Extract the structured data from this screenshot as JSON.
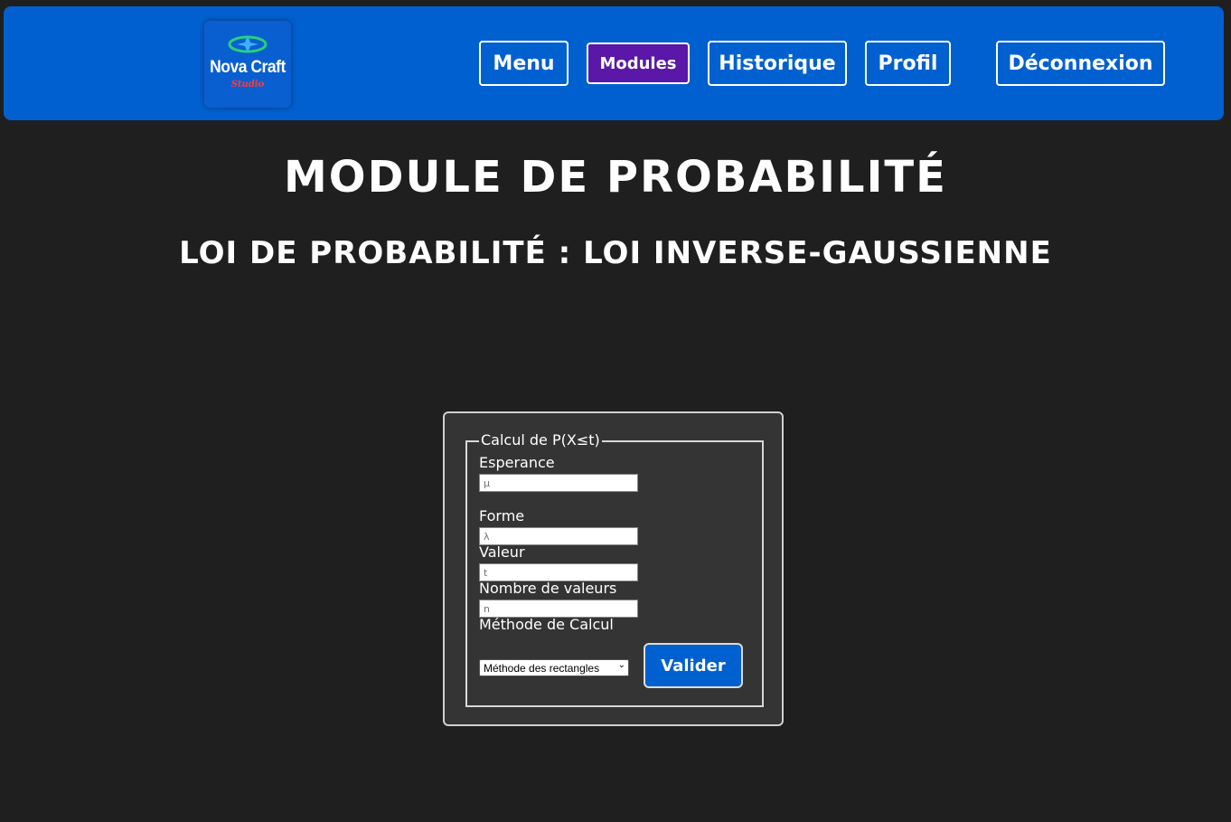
{
  "header": {
    "logo": {
      "name": "Nova Craft",
      "sub": "Studio"
    },
    "nav": [
      {
        "label": "Menu"
      },
      {
        "label": "Modules",
        "active": true
      },
      {
        "label": "Historique"
      },
      {
        "label": "Profil"
      },
      {
        "label": "Déconnexion"
      }
    ]
  },
  "page": {
    "title": "MODULE DE PROBABILITÉ",
    "subtitle": "LOI DE PROBABILITÉ : LOI INVERSE-GAUSSIENNE"
  },
  "form": {
    "legend": "Calcul de P(X≤t)",
    "fields": [
      {
        "label": "Esperance",
        "placeholder": "μ"
      },
      {
        "label": "Forme",
        "placeholder": "λ"
      },
      {
        "label": "Valeur",
        "placeholder": "t"
      },
      {
        "label": "Nombre de valeurs",
        "placeholder": "n"
      }
    ],
    "method_label": "Méthode de Calcul",
    "method_selected": "Méthode des rectangles",
    "submit": "Valider"
  },
  "colors": {
    "header_bg": "#0060d0",
    "active_nav": "#5a17a8",
    "page_bg": "#1f1f1f",
    "card_bg": "#343434"
  }
}
